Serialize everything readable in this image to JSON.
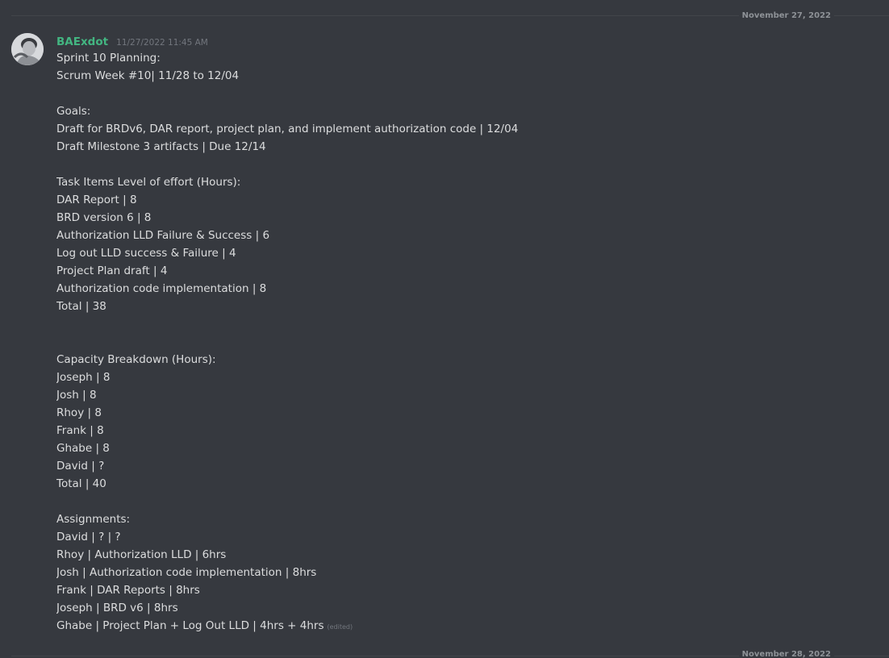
{
  "dividers": {
    "top_date": "November 27, 2022",
    "bottom_date": "November 28, 2022"
  },
  "message": {
    "username": "BAExdot",
    "timestamp": "11/27/2022 11:45 AM",
    "edited_label": "(edited)",
    "lines": [
      "Sprint 10 Planning:",
      "Scrum Week #10| 11/28 to 12/04",
      "",
      "Goals:",
      "Draft for BRDv6, DAR report, project plan, and implement authorization code | 12/04",
      "Draft Milestone 3 artifacts | Due 12/14",
      "",
      "Task Items Level of effort (Hours):",
      "DAR Report | 8",
      "BRD version 6 | 8",
      "Authorization LLD Failure & Success | 6",
      "Log out LLD success & Failure | 4",
      "Project Plan draft | 4",
      "Authorization code implementation | 8",
      "Total | 38",
      "",
      "",
      "Capacity Breakdown (Hours):",
      "Joseph | 8",
      "Josh | 8",
      "Rhoy | 8",
      "Frank | 8",
      "Ghabe | 8",
      "David | ?",
      "Total | 40",
      "",
      "Assignments:",
      "David | ? | ?",
      "Rhoy | Authorization LLD | 6hrs",
      "Josh | Authorization code implementation | 8hrs",
      "Frank | DAR Reports | 8hrs",
      "Joseph | BRD v6 | 8hrs",
      "Ghabe | Project Plan + Log Out LLD | 4hrs + 4hrs"
    ]
  },
  "colors": {
    "background": "#36393f",
    "username": "#43b581",
    "text": "#dcddde",
    "muted": "#72767d"
  }
}
